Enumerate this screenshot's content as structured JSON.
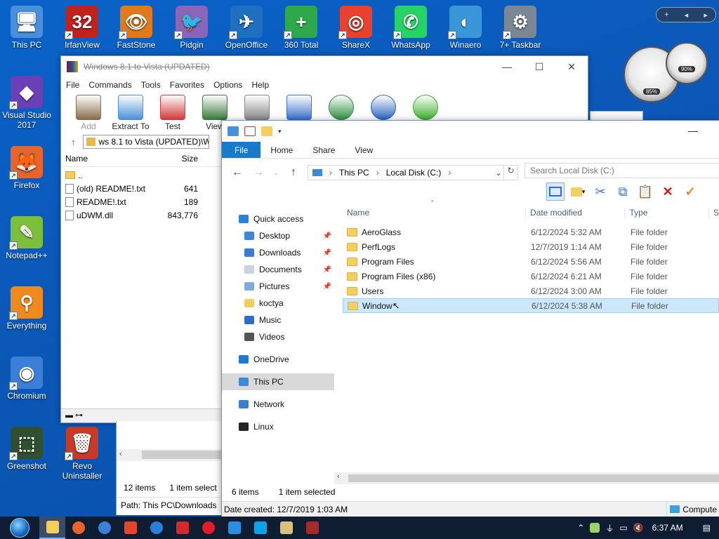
{
  "desktop": {
    "icons": [
      {
        "label": "This PC",
        "glyph": "🖥",
        "color": "#4a8fdc"
      },
      {
        "label": "IrfanView",
        "glyph": "32",
        "color": "#c0221c"
      },
      {
        "label": "FastStone",
        "glyph": "👁",
        "color": "#e07a1a"
      },
      {
        "label": "Pidgin",
        "glyph": "🐦",
        "color": "#8b65b8"
      },
      {
        "label": "OpenOffice",
        "glyph": "✈",
        "color": "#1e6fc0"
      },
      {
        "label": "360 Total",
        "glyph": "+",
        "color": "#2ea84a"
      },
      {
        "label": "ShareX",
        "glyph": "◎",
        "color": "#e8412f"
      },
      {
        "label": "WhatsApp",
        "glyph": "✆",
        "color": "#25d366"
      },
      {
        "label": "Winaero",
        "glyph": "◐",
        "color": "#3a96d8"
      },
      {
        "label": "7+ Taskbar",
        "glyph": "⚙",
        "color": "#7b8794"
      },
      {
        "label": "Visual Studio 2017",
        "glyph": "◆",
        "color": "#6b3fb6"
      },
      {
        "label": "Firefox",
        "glyph": "🦊",
        "color": "#e8642c"
      },
      {
        "label": "Notepad++",
        "glyph": "✎",
        "color": "#7cbf3a"
      },
      {
        "label": "Everything",
        "glyph": "⚲",
        "color": "#f08a1c"
      },
      {
        "label": "Chromium",
        "glyph": "◉",
        "color": "#3b7fd8"
      },
      {
        "label": "Greenshot",
        "glyph": "⬚",
        "color": "#2f4f2f"
      },
      {
        "label": "Revo Uninstaller",
        "glyph": "🗑",
        "color": "#c83a28"
      }
    ]
  },
  "winrar": {
    "title": "Windows 8.1 to Vista (UPDATED)",
    "menu": [
      "File",
      "Commands",
      "Tools",
      "Favorites",
      "Options",
      "Help"
    ],
    "toolbar": [
      {
        "label": "Add",
        "color": "#8a6d4b",
        "disabled": true
      },
      {
        "label": "Extract To",
        "color": "#4a90d9",
        "disabled": false
      },
      {
        "label": "Test",
        "color": "#d23b3b",
        "disabled": false
      },
      {
        "label": "View",
        "color": "#3a7a3a",
        "disabled": false
      },
      {
        "label": "",
        "color": "#888",
        "disabled": false
      },
      {
        "label": "",
        "color": "#3a73c9",
        "disabled": false
      },
      {
        "label": "",
        "color": "#2f8f3f",
        "disabled": false
      },
      {
        "label": "",
        "color": "#2a66c0",
        "disabled": false
      },
      {
        "label": "",
        "color": "#3fae2a",
        "disabled": false
      }
    ],
    "address": "ws 8.1 to Vista (UPDATED)\\W",
    "columns": {
      "name": "Name",
      "size": "Size"
    },
    "files": [
      {
        "name": "..",
        "size": "",
        "folder": true
      },
      {
        "name": "(old) README!.txt",
        "size": "641",
        "folder": false
      },
      {
        "name": "README!.txt",
        "size": "189",
        "folder": false
      },
      {
        "name": "uDWM.dll",
        "size": "843,776",
        "folder": false
      }
    ]
  },
  "behind_window": {
    "items_count": "12 items",
    "selected": "1 item select",
    "path": "Path: This PC\\Downloads"
  },
  "explorer": {
    "ribbon_tabs": [
      "File",
      "Home",
      "Share",
      "View"
    ],
    "breadcrumb": [
      "This PC",
      "Local Disk (C:)"
    ],
    "search_placeholder": "Search Local Disk (C:)",
    "nav": [
      {
        "label": "Quick access",
        "color": "#2a7fd6",
        "pin": false,
        "indent": 0
      },
      {
        "label": "Desktop",
        "color": "#3d87d6",
        "pin": true,
        "indent": 1
      },
      {
        "label": "Downloads",
        "color": "#3a7bd5",
        "pin": true,
        "indent": 1
      },
      {
        "label": "Documents",
        "color": "#c9d3e0",
        "pin": true,
        "indent": 1
      },
      {
        "label": "Pictures",
        "color": "#7faad9",
        "pin": true,
        "indent": 1
      },
      {
        "label": "koctya",
        "color": "#f3cd5d",
        "pin": false,
        "indent": 1
      },
      {
        "label": "Music",
        "color": "#2b6fc9",
        "pin": false,
        "indent": 1
      },
      {
        "label": "Videos",
        "color": "#555",
        "pin": false,
        "indent": 1
      },
      {
        "label": "OneDrive",
        "color": "#1f78d1",
        "pin": false,
        "indent": 0
      },
      {
        "label": "This PC",
        "color": "#3c8ad8",
        "pin": false,
        "indent": 0,
        "selected": true
      },
      {
        "label": "Network",
        "color": "#3a7fc8",
        "pin": false,
        "indent": 0
      },
      {
        "label": "Linux",
        "color": "#222",
        "pin": false,
        "indent": 0
      }
    ],
    "columns": {
      "name": "Name",
      "date": "Date modified",
      "type": "Type",
      "size": "S"
    },
    "rows": [
      {
        "name": "AeroGlass",
        "date": "6/12/2024 5:32 AM",
        "type": "File folder"
      },
      {
        "name": "PerfLogs",
        "date": "12/7/2019 1:14 AM",
        "type": "File folder"
      },
      {
        "name": "Program Files",
        "date": "6/12/2024 5:56 AM",
        "type": "File folder"
      },
      {
        "name": "Program Files (x86)",
        "date": "6/12/2024 6:21 AM",
        "type": "File folder"
      },
      {
        "name": "Users",
        "date": "6/12/2024 3:00 AM",
        "type": "File folder"
      },
      {
        "name": "Window",
        "date": "6/12/2024 5:38 AM",
        "type": "File folder",
        "selected": true
      }
    ],
    "status_items": "6 items",
    "status_selected": "1 item selected",
    "date_created": "Date created: 12/7/2019 1:03 AM",
    "computer": "Compute"
  },
  "gadget": {
    "cpu": "85%",
    "ram": "90%"
  },
  "taskbar": {
    "apps": [
      {
        "name": "explorer",
        "color": "#f3cd5d",
        "active": true
      },
      {
        "name": "firefox",
        "color": "#e8642c"
      },
      {
        "name": "chromium",
        "color": "#3b7fd8"
      },
      {
        "name": "brave",
        "color": "#e2452b"
      },
      {
        "name": "thunderbird",
        "color": "#2a7fd6"
      },
      {
        "name": "wps",
        "color": "#d12b2b"
      },
      {
        "name": "opera",
        "color": "#e21a2a"
      },
      {
        "name": "bluetooth-app",
        "color": "#2a8de0"
      },
      {
        "name": "skype",
        "color": "#0aa3e8"
      },
      {
        "name": "notepad",
        "color": "#d9c27a"
      },
      {
        "name": "winrar",
        "color": "#a52a2a"
      }
    ],
    "time": "6:37 AM"
  }
}
